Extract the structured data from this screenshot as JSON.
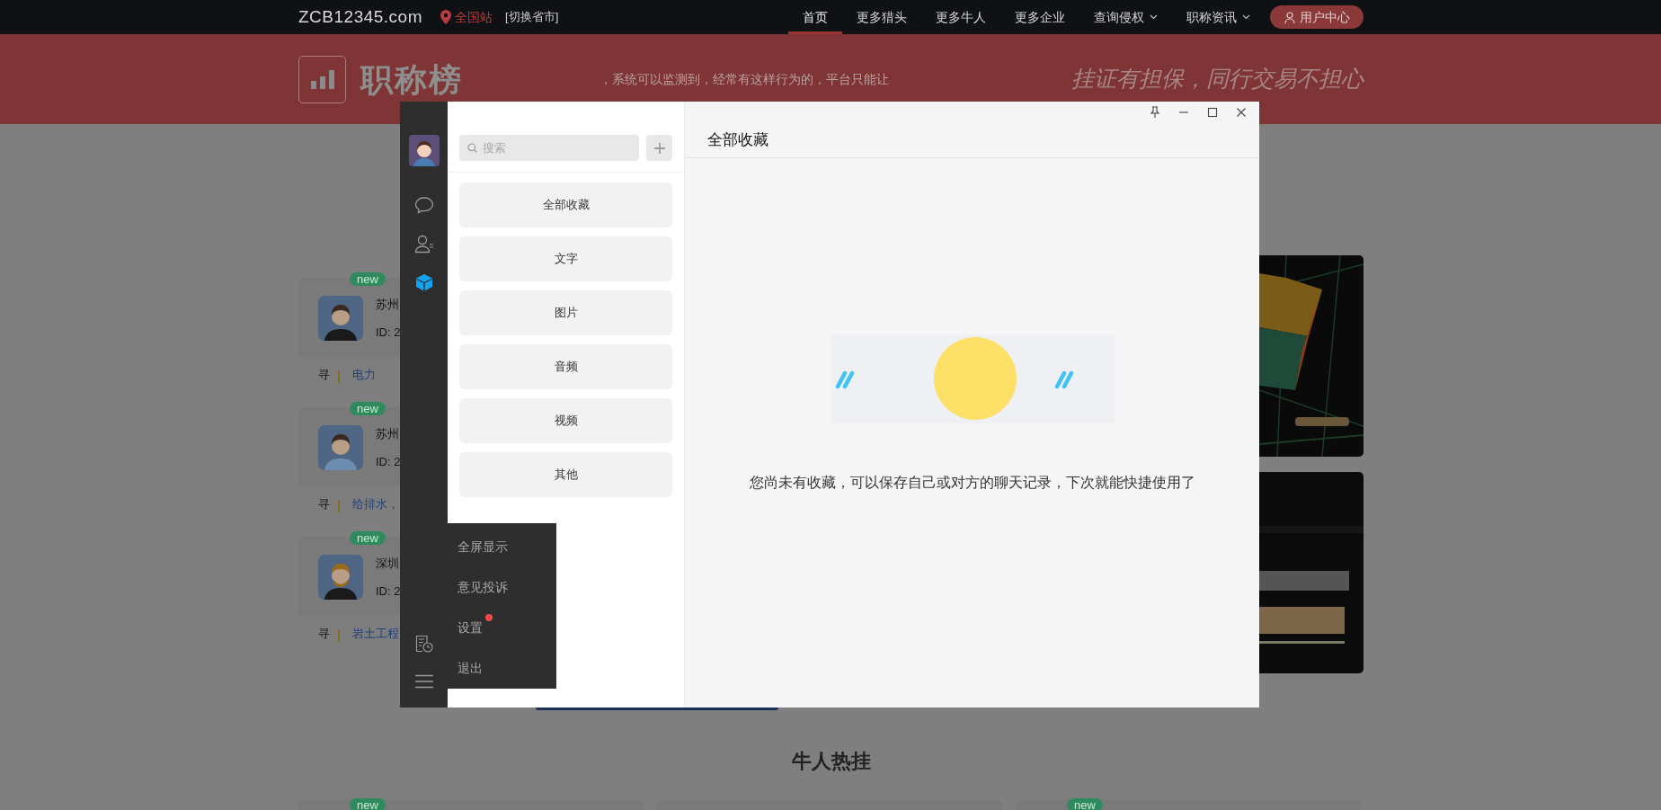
{
  "top_nav": {
    "logo": "ZCB12345.com",
    "location": "全国站",
    "switch_city": "[切换省市]",
    "items": [
      {
        "label": "首页",
        "selected": true,
        "dropdown": false
      },
      {
        "label": "更多猎头",
        "selected": false,
        "dropdown": false
      },
      {
        "label": "更多牛人",
        "selected": false,
        "dropdown": false
      },
      {
        "label": "更多企业",
        "selected": false,
        "dropdown": false
      },
      {
        "label": "查询侵权",
        "selected": false,
        "dropdown": true
      },
      {
        "label": "职称资讯",
        "selected": false,
        "dropdown": true
      }
    ],
    "user_button": "用户中心"
  },
  "banner": {
    "title": "职称榜",
    "marquee": "，系统可以监测到，经常有这样行为的，平台只能让",
    "slogan": "挂证有担保，同行交易不担心"
  },
  "talent_cards": [
    {
      "badge": "new",
      "name": "苏州",
      "id": "ID: 2",
      "tag_prefix": "寻",
      "tag": "电力",
      "kind": "man"
    },
    {
      "badge": "new",
      "name": "苏州",
      "id": "ID: 2",
      "tag_prefix": "寻",
      "tag": "给排水，",
      "kind": "woman"
    },
    {
      "badge": "new",
      "name": "深圳",
      "id": "ID: 2",
      "tag_prefix": "寻",
      "tag": "岩土工程",
      "kind": "bearded"
    }
  ],
  "section_title": "牛人热挂",
  "hot_cards": [
    {
      "kind": "badged",
      "badge": "new"
    },
    {
      "kind": "plain"
    },
    {
      "kind": "badged",
      "badge": "new"
    }
  ],
  "chat_window": {
    "controls": [
      {
        "kind": "pin"
      },
      {
        "kind": "minimize"
      },
      {
        "kind": "maximize"
      },
      {
        "kind": "close"
      }
    ],
    "sidebar": [
      {
        "kind": "chat",
        "selected": false
      },
      {
        "kind": "contacts",
        "selected": false
      },
      {
        "kind": "favorites",
        "selected": true
      }
    ],
    "sidebar_bottom": [
      {
        "kind": "history"
      },
      {
        "kind": "menu"
      }
    ],
    "search": {
      "placeholder": "搜索"
    },
    "categories": [
      "全部收藏",
      "文字",
      "图片",
      "音频",
      "视频",
      "其他"
    ],
    "header": "全部收藏",
    "empty_text": "您尚未有收藏，可以保存自己或对方的聊天记录，下次就能快捷使用了",
    "menu": [
      {
        "label": "全屏显示",
        "dot": false
      },
      {
        "label": "意见投诉",
        "dot": false
      },
      {
        "label": "设置",
        "dot": true
      },
      {
        "label": "退出",
        "dot": false
      }
    ]
  }
}
